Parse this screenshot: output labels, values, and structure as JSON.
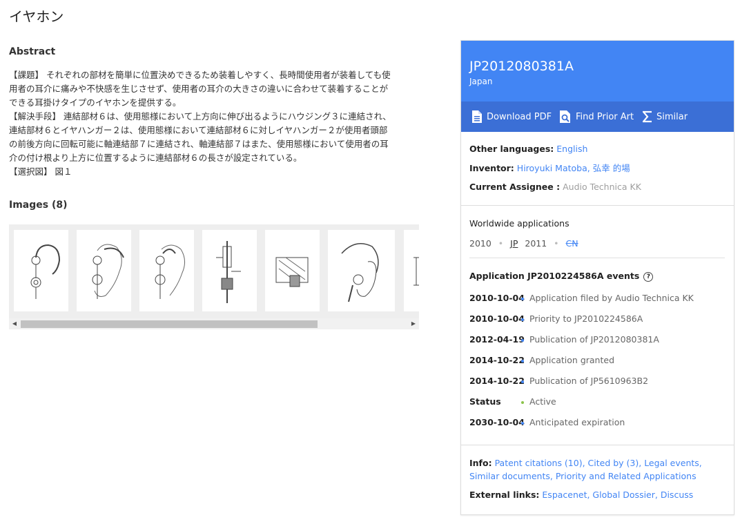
{
  "page": {
    "title": "イヤホン"
  },
  "abstract": {
    "heading": "Abstract",
    "text": "【課題】 それぞれの部材を簡単に位置決めできるため装着しやすく、長時間使用者が装着しても使\n用者の耳介に痛みや不快感を生じさせず、使用者の耳介の大きさの違いに合わせて装着することが\nできる耳掛けタイプのイヤホンを提供する。\n【解決手段】 連結部材６は、使用態様において上方向に伸び出るようにハウジング３に連結され、\n連結部材６とイヤハンガー２は、使用態様において連結部材６に対しイヤハンガー２が使用者頭部\nの前後方向に回転可能に軸連結部７に連結され、軸連結部７はまた、使用態様において使用者の耳\n介の付け根より上方に位置するように連結部材６の長さが設定されている。\n【選択図】 図１"
  },
  "images": {
    "heading": "Images (8)",
    "thumbnails": [
      "figure-1",
      "figure-2",
      "figure-3",
      "figure-4",
      "figure-5",
      "figure-6",
      "figure-7"
    ]
  },
  "panel": {
    "patent_number": "JP2012080381A",
    "country": "Japan",
    "actions": {
      "download": "Download PDF",
      "prior_art": "Find Prior Art",
      "similar": "Similar"
    },
    "other_languages_label": "Other languages:",
    "other_languages_value": "English",
    "inventor_label": "Inventor:",
    "inventor_value": "Hiroyuki Matoba, 弘幸 的場",
    "assignee_label": "Current Assignee :",
    "assignee_value": "Audio Technica KK",
    "worldwide_heading": "Worldwide applications",
    "worldwide": {
      "y1": "2010",
      "sep1": "•",
      "jp": "JP",
      "y2": "2011",
      "sep2": "•",
      "cn": "CN"
    },
    "events_heading": "Application JP2010224586A events",
    "events": [
      {
        "date": "2010-10-04",
        "text": "Application filed by Audio Technica KK"
      },
      {
        "date": "2010-10-04",
        "text": "Priority to JP2010224586A"
      },
      {
        "date": "2012-04-19",
        "text": "Publication of JP2012080381A"
      },
      {
        "date": "2014-10-22",
        "text": "Application granted"
      },
      {
        "date": "2014-10-22",
        "text": "Publication of JP5610963B2"
      },
      {
        "date": "Status",
        "text": "Active"
      },
      {
        "date": "2030-10-04",
        "text": "Anticipated expiration"
      }
    ],
    "info_label": "Info:",
    "info_links": "Patent citations (10), Cited by (3), Legal events, Similar documents, Priority and Related Applications",
    "external_label": "External links:",
    "external_links": "Espacenet, Global Dossier, Discuss"
  },
  "colors": {
    "accent": "#4285f4",
    "action_bar": "#3b6fd6",
    "status_active": "#8bc34a"
  },
  "icons": [
    "document-icon",
    "search-document-icon",
    "sigma-icon",
    "help-icon"
  ]
}
